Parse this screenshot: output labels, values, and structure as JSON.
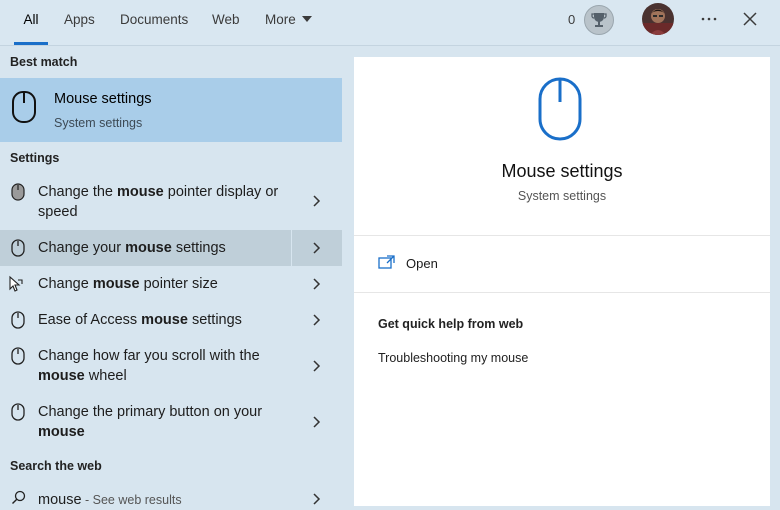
{
  "tabs": [
    {
      "label": "All"
    },
    {
      "label": "Apps"
    },
    {
      "label": "Documents"
    },
    {
      "label": "Web"
    },
    {
      "label": "More"
    }
  ],
  "header": {
    "points": "0"
  },
  "left": {
    "best_match_heading": "Best match",
    "best_match": {
      "title": "Mouse settings",
      "subtitle": "System settings"
    },
    "settings_heading": "Settings",
    "settings_items": [
      {
        "pre": "Change the ",
        "bold": "mouse",
        "post": " pointer display or speed"
      },
      {
        "pre": "Change your ",
        "bold": "mouse",
        "post": " settings"
      },
      {
        "pre": "Change ",
        "bold": "mouse",
        "post": " pointer size"
      },
      {
        "pre": "Ease of Access ",
        "bold": "mouse",
        "post": " settings"
      },
      {
        "pre": "Change how far you scroll with the ",
        "bold": "mouse",
        "post": " wheel"
      },
      {
        "pre": "Change the primary button on your ",
        "bold": "mouse",
        "post": ""
      }
    ],
    "web_heading": "Search the web",
    "web_item": {
      "query": "mouse",
      "hint": " - See web results"
    }
  },
  "preview": {
    "title": "Mouse settings",
    "subtitle": "System settings",
    "open_label": "Open",
    "help_heading": "Get quick help from web",
    "help_link": "Troubleshooting my mouse"
  },
  "colors": {
    "accent": "#1a6fc9",
    "selected_bg": "#a9cde9",
    "hover_bg": "#bfcfd9"
  }
}
